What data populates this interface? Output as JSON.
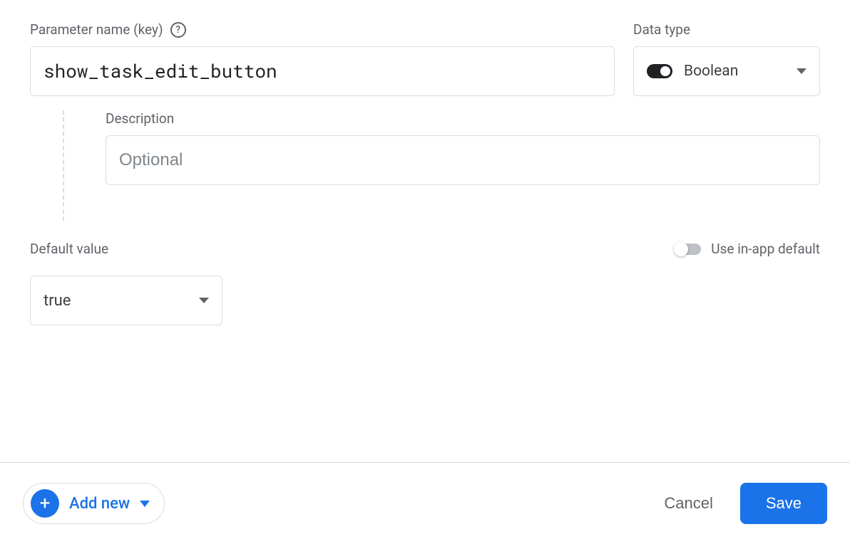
{
  "parameter": {
    "name_label": "Parameter name (key)",
    "name_value": "show_task_edit_button",
    "data_type_label": "Data type",
    "data_type_value": "Boolean"
  },
  "description": {
    "label": "Description",
    "placeholder": "Optional",
    "value": ""
  },
  "default_value": {
    "label": "Default value",
    "value": "true",
    "use_in_app_label": "Use in-app default",
    "use_in_app_enabled": false
  },
  "footer": {
    "add_new_label": "Add new",
    "cancel_label": "Cancel",
    "save_label": "Save"
  }
}
